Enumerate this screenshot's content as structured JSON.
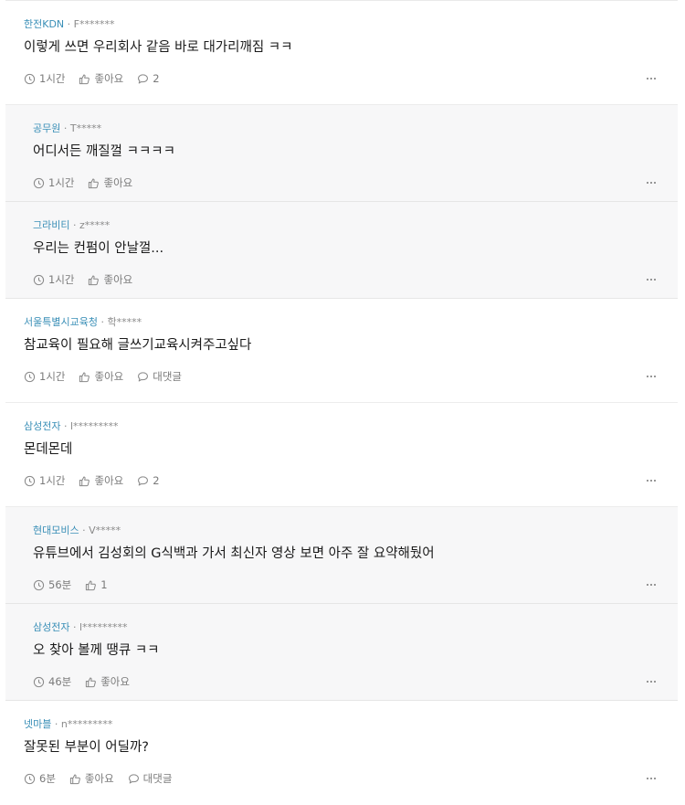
{
  "comments": [
    {
      "company": "한전KDN",
      "user": "F*******",
      "text": "이렇게 쓰면 우리회사 같음 바로 대가리깨짐 ㅋㅋ",
      "time": "1시간",
      "like": "좋아요",
      "reply": "2",
      "reply_icon": "speech-bubble-icon",
      "is_reply": false
    },
    {
      "company": "공무원",
      "user": "T*****",
      "text": "어디서든 깨질껄 ㅋㅋㅋㅋ",
      "time": "1시간",
      "like": "좋아요",
      "is_reply": true
    },
    {
      "company": "그라비티",
      "user": "z*****",
      "text": "우리는 컨펌이 안날껄...",
      "time": "1시간",
      "like": "좋아요",
      "is_reply": true
    },
    {
      "company": "서울특별시교육청",
      "user": "학*****",
      "text": "참교육이 필요해 글쓰기교육시켜주고싶다",
      "time": "1시간",
      "like": "좋아요",
      "reply": "대댓글",
      "is_reply": false
    },
    {
      "company": "삼성전자",
      "user": "l*********",
      "text": "몬데몬데",
      "time": "1시간",
      "like": "좋아요",
      "reply": "2",
      "is_reply": false
    },
    {
      "company": "현대모비스",
      "user": "V*****",
      "text": "유튜브에서 김성회의 G식백과 가서 최신자 영상 보면 아주 잘 요약해뒀어",
      "time": "56분",
      "like": "1",
      "is_reply": true
    },
    {
      "company": "삼성전자",
      "user": "l*********",
      "text": "오 찾아 볼께 땡큐 ㅋㅋ",
      "time": "46분",
      "like": "좋아요",
      "is_reply": true
    },
    {
      "company": "넷마블",
      "user": "n*********",
      "text": "잘못된 부분이 어딜까?",
      "time": "6분",
      "like": "좋아요",
      "reply": "대댓글",
      "is_reply": false
    }
  ],
  "separator": "·",
  "colors": {
    "company": "#3a8fb7",
    "meta": "#8a8a8a",
    "reply_bg": "#f7f7f8"
  }
}
